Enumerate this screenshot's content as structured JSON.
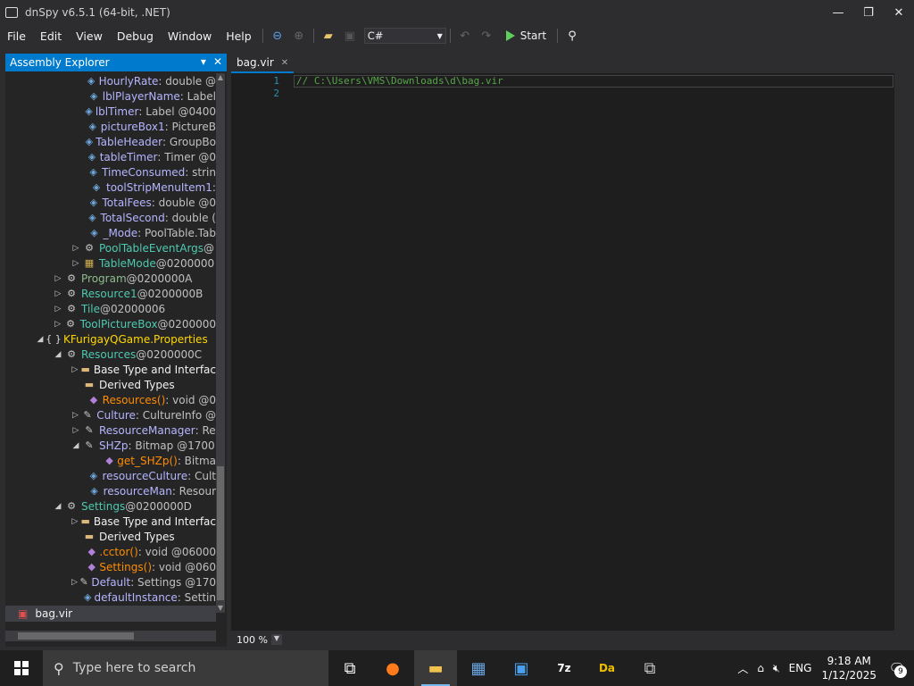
{
  "window": {
    "title": "dnSpy v6.5.1 (64-bit, .NET)",
    "buttons": [
      "minimize",
      "restore",
      "close"
    ]
  },
  "menu": [
    "File",
    "Edit",
    "View",
    "Debug",
    "Window",
    "Help"
  ],
  "toolbar": {
    "language": "C#",
    "start_label": "Start"
  },
  "explorer": {
    "title": "Assembly Explorer",
    "rows": [
      {
        "indent": 92,
        "exp": "",
        "icon": "field-icon",
        "name": "HourlyRate",
        "rest": " : double @",
        "cls": "c-field"
      },
      {
        "indent": 92,
        "exp": "",
        "icon": "field-icon",
        "name": "lblPlayerName",
        "rest": " : Label",
        "cls": "c-field"
      },
      {
        "indent": 92,
        "exp": "",
        "icon": "field-icon",
        "name": "lblTimer",
        "rest": " : Label @0400",
        "cls": "c-field"
      },
      {
        "indent": 92,
        "exp": "",
        "icon": "field-icon",
        "name": "pictureBox1",
        "rest": " : PictureB",
        "cls": "c-field"
      },
      {
        "indent": 92,
        "exp": "",
        "icon": "field-icon",
        "name": "TableHeader",
        "rest": " : GroupBo",
        "cls": "c-field"
      },
      {
        "indent": 92,
        "exp": "",
        "icon": "field-icon",
        "name": "tableTimer",
        "rest": " : Timer @0",
        "cls": "c-field"
      },
      {
        "indent": 92,
        "exp": "",
        "icon": "field-icon",
        "name": "TimeConsumed",
        "rest": " : strin",
        "cls": "c-field"
      },
      {
        "indent": 92,
        "exp": "",
        "icon": "field-icon",
        "name": "toolStripMenuItem1",
        "rest": " :",
        "cls": "c-field"
      },
      {
        "indent": 92,
        "exp": "",
        "icon": "field-icon",
        "name": "TotalFees",
        "rest": " : double @0",
        "cls": "c-field"
      },
      {
        "indent": 92,
        "exp": "",
        "icon": "field-icon",
        "name": "TotalSecond",
        "rest": " : double (",
        "cls": "c-field"
      },
      {
        "indent": 92,
        "exp": "",
        "icon": "field-icon",
        "name": "_Mode",
        "rest": " : PoolTable.Tab",
        "cls": "c-field"
      },
      {
        "indent": 84,
        "exp": "▷",
        "icon": "class-icon",
        "name": "PoolTableEventArgs",
        "rest": " @",
        "cls": "c-type"
      },
      {
        "indent": 84,
        "exp": "▷",
        "icon": "enum-icon",
        "name": "TableMode",
        "rest": " @0200000",
        "cls": "c-type"
      },
      {
        "indent": 64,
        "exp": "▷",
        "icon": "class-icon",
        "name": "Program",
        "rest": " @0200000A",
        "cls": "c-gray"
      },
      {
        "indent": 64,
        "exp": "▷",
        "icon": "class-icon",
        "name": "Resource1",
        "rest": " @0200000B",
        "cls": "c-type"
      },
      {
        "indent": 64,
        "exp": "▷",
        "icon": "class-icon",
        "name": "Tile",
        "rest": " @02000006",
        "cls": "c-type"
      },
      {
        "indent": 64,
        "exp": "▷",
        "icon": "class-icon",
        "name": "ToolPictureBox",
        "rest": " @0200000",
        "cls": "c-type"
      },
      {
        "indent": 44,
        "exp": "◢",
        "icon": "namespace-icon",
        "name": "KFurigayQGame.Properties",
        "rest": "",
        "cls": "c-ns"
      },
      {
        "indent": 64,
        "exp": "◢",
        "icon": "class-icon",
        "name": "Resources",
        "rest": " @0200000C",
        "cls": "c-type"
      },
      {
        "indent": 84,
        "exp": "▷",
        "icon": "folder-icon",
        "name": "Base Type and Interfac",
        "rest": "",
        "cls": ""
      },
      {
        "indent": 84,
        "exp": "",
        "icon": "folder-icon",
        "name": "Derived Types",
        "rest": "",
        "cls": ""
      },
      {
        "indent": 92,
        "exp": "",
        "icon": "method-icon",
        "name": "Resources()",
        "rest": " : void @0",
        "cls": "c-meth"
      },
      {
        "indent": 84,
        "exp": "▷",
        "icon": "property-icon",
        "name": "Culture",
        "rest": " : CultureInfo @",
        "cls": "c-prop"
      },
      {
        "indent": 84,
        "exp": "▷",
        "icon": "property-icon",
        "name": "ResourceManager",
        "rest": " : Re",
        "cls": "c-prop"
      },
      {
        "indent": 84,
        "exp": "◢",
        "icon": "property-icon",
        "name": "SHZp",
        "rest": " : Bitmap @1700",
        "cls": "c-prop"
      },
      {
        "indent": 112,
        "exp": "",
        "icon": "method-icon",
        "name": "get_SHZp()",
        "rest": " : Bitma",
        "cls": "c-meth"
      },
      {
        "indent": 92,
        "exp": "",
        "icon": "field-icon",
        "name": "resourceCulture",
        "rest": " : Cult",
        "cls": "c-field"
      },
      {
        "indent": 92,
        "exp": "",
        "icon": "field-icon",
        "name": "resourceMan",
        "rest": " : Resour",
        "cls": "c-field"
      },
      {
        "indent": 64,
        "exp": "◢",
        "icon": "class-icon",
        "name": "Settings",
        "rest": " @0200000D",
        "cls": "c-type"
      },
      {
        "indent": 84,
        "exp": "▷",
        "icon": "folder-icon",
        "name": "Base Type and Interfac",
        "rest": "",
        "cls": ""
      },
      {
        "indent": 84,
        "exp": "",
        "icon": "folder-icon",
        "name": "Derived Types",
        "rest": "",
        "cls": ""
      },
      {
        "indent": 92,
        "exp": "",
        "icon": "method-icon",
        "name": ".cctor()",
        "rest": " : void @06000",
        "cls": "c-meth"
      },
      {
        "indent": 92,
        "exp": "",
        "icon": "method-icon",
        "name": "Settings()",
        "rest": " : void @060",
        "cls": "c-meth"
      },
      {
        "indent": 84,
        "exp": "▷",
        "icon": "property-icon",
        "name": "Default",
        "rest": " : Settings @170",
        "cls": "c-prop"
      },
      {
        "indent": 92,
        "exp": "",
        "icon": "field-icon",
        "name": "defaultInstance",
        "rest": " : Settin",
        "cls": "c-field"
      }
    ],
    "bottom_item": "bag.vir"
  },
  "editor": {
    "tab_label": "bag.vir",
    "line_numbers": [
      "1",
      "2"
    ],
    "code_line": "// C:\\Users\\VMS\\Downloads\\d\\bag.vir",
    "zoom": "100 %"
  },
  "taskbar": {
    "search_placeholder": "Type here to search",
    "language": "ENG",
    "time": "9:18 AM",
    "date": "1/12/2025",
    "notification_count": "9"
  }
}
